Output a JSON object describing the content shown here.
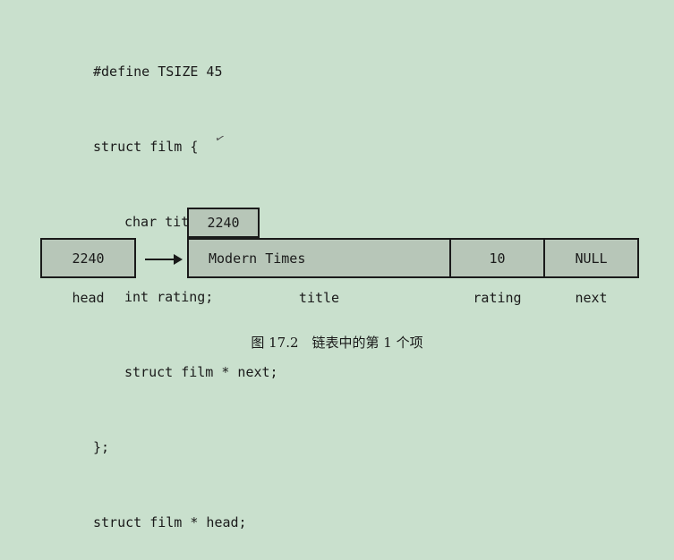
{
  "code": {
    "lines": [
      "#define TSIZE 45",
      "struct film {",
      "char title[TSIZE]",
      "int rating;",
      "struct film * next;",
      "};",
      "struct film * head;"
    ],
    "mark": "✓"
  },
  "diagram": {
    "head_value": "2240",
    "node_address": "2240",
    "title_value": "Modern Times",
    "rating_value": "10",
    "next_value": "NULL",
    "labels": {
      "head": "head",
      "title": "title",
      "rating": "rating",
      "next": "next"
    }
  },
  "caption": "图 17.2　链表中的第 1 个项"
}
